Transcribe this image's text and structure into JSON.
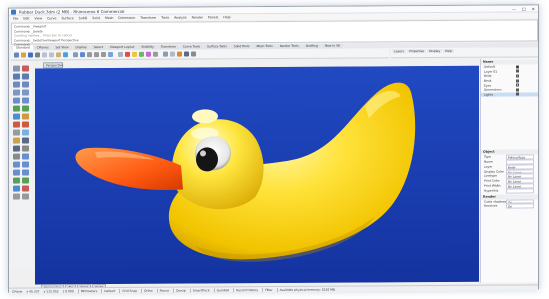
{
  "window": {
    "title": "Rubber Duck.3dm (2 MB) - Rhinoceros 6 Commercial",
    "controls": [
      "—",
      "□",
      "✕"
    ]
  },
  "menubar": [
    "File",
    "Edit",
    "View",
    "Curve",
    "Surface",
    "SubD",
    "Solid",
    "Mesh",
    "Dimension",
    "Transform",
    "Tools",
    "Analyze",
    "Render",
    "Panels",
    "Help"
  ],
  "command_history": {
    "lines": [
      "Command: _Viewport",
      "Command: _Delete",
      "Creating meshes... Press Esc to cancel",
      "Command: _SetActiveViewport Perspective"
    ],
    "prompt": "Command:"
  },
  "toolbar_tabs": [
    "Standard",
    "CPlanes",
    "Set View",
    "Display",
    "Select",
    "Viewport Layout",
    "Visibility",
    "Transform",
    "Curve Tools",
    "Surface Tools",
    "Solid Tools",
    "Mesh Tools",
    "Render Tools",
    "Drafting",
    "New in V6"
  ],
  "viewport": {
    "label": "Perspective",
    "tabs": [
      "Perspective",
      "Top",
      "Front",
      "Right"
    ],
    "background": "#1a3fb2"
  },
  "right_panel": {
    "tabs": [
      "Layers",
      "Properties",
      "Display",
      "Help"
    ],
    "layers_header": "Name",
    "layers": [
      {
        "name": "Default",
        "color": "#111111",
        "selected": false
      },
      {
        "name": "Layer 01",
        "color": "#ff2020",
        "selected": false
      },
      {
        "name": "Body",
        "color": "#ffd400",
        "selected": false
      },
      {
        "name": "Beak",
        "color": "#ff5a10",
        "selected": false
      },
      {
        "name": "Eyes",
        "color": "#ffffff",
        "selected": false
      },
      {
        "name": "Dimensions",
        "color": "#2a6de0",
        "selected": false
      },
      {
        "name": "Lights",
        "color": "#7a2ad8",
        "selected": true
      }
    ],
    "properties_title": "Object",
    "properties": [
      {
        "key": "Type",
        "value": "Polysurface"
      },
      {
        "key": "Name",
        "value": ""
      },
      {
        "key": "Layer",
        "value": "Body"
      },
      {
        "key": "Display Color",
        "value": "By Layer"
      },
      {
        "key": "Linetype",
        "value": "By Layer"
      },
      {
        "key": "Print Color",
        "value": "By Layer"
      },
      {
        "key": "Print Width",
        "value": "By Layer"
      },
      {
        "key": "Hyperlink",
        "value": ""
      }
    ],
    "render_title": "Render",
    "render_props": [
      {
        "key": "Casts shadows",
        "value": "On"
      },
      {
        "key": "Receives",
        "value": "On"
      }
    ]
  },
  "statusbar": {
    "cplane": "CPlane",
    "x": "x 45.337",
    "y": "y 112.052",
    "z": "z 0.000",
    "units": "Millimeters",
    "layer": "Default",
    "toggles": [
      "Grid Snap",
      "Ortho",
      "Planar",
      "Osnap",
      "SmartTrack",
      "Gumball",
      "Record History",
      "Filter"
    ],
    "status": "Available physical memory: 5210 MB"
  }
}
